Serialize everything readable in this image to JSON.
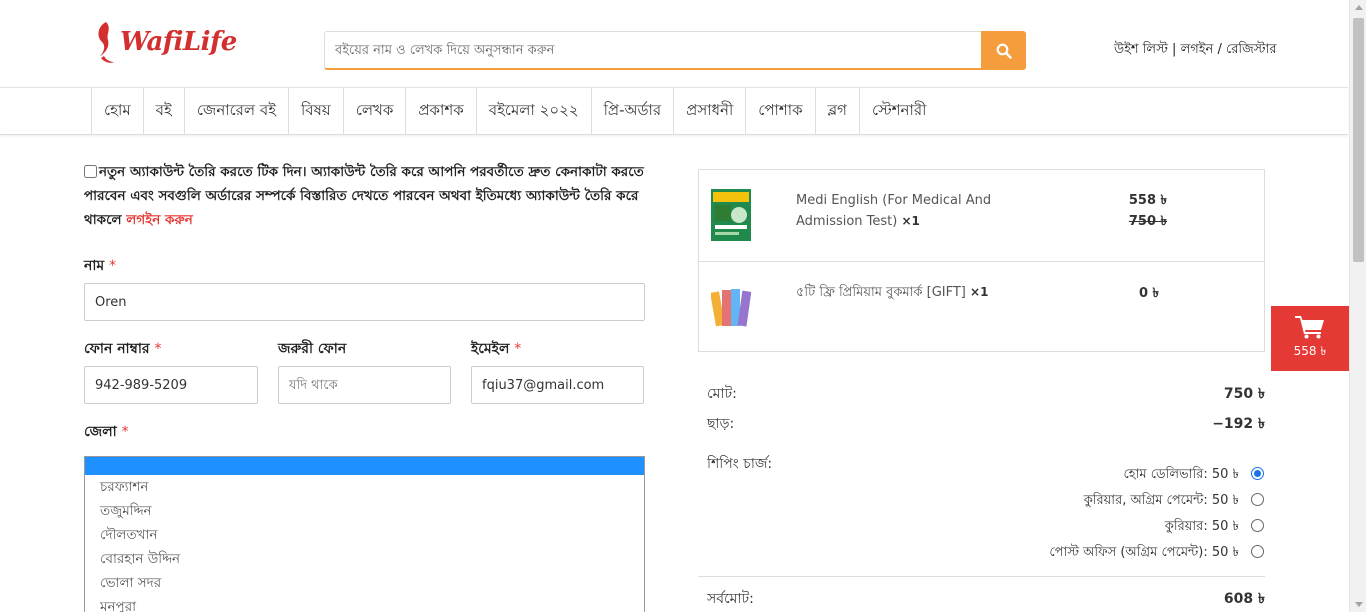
{
  "brand": {
    "name": "WafiLife",
    "color": "#d32f2f"
  },
  "search": {
    "placeholder": "বইয়ের নাম ও লেখক দিয়ে অনুসন্ধান করুন",
    "icon": "search-icon",
    "accent": "#f59d3d"
  },
  "account": {
    "wishlist": "উইশ লিস্ট",
    "sep1": " | ",
    "login": "লগইন",
    "sep2": " / ",
    "register": "রেজিস্টার"
  },
  "nav": {
    "items": [
      "হোম",
      "বই",
      "জেনারেল বই",
      "বিষয়",
      "লেখক",
      "প্রকাশক",
      "বইমেলা ২০২২",
      "প্রি-অর্ডার",
      "প্রসাধনী",
      "পোশাক",
      "ব্লগ",
      "স্টেশনারী"
    ]
  },
  "form": {
    "create_account_text": "নতুন অ্যাকাউন্ট তৈরি করতে টিক দিন। অ্যাকাউন্ট তৈরি করে আপনি পরবর্তীতে দ্রুত কেনাকাটা করতে পারবেন এবং সবগুলি অর্ডারের সম্পর্কে বিস্তারিত দেখতে পারবেন অথবা ইতিমধ্যে অ্যাকাউন্ট তৈরি করে থাকলে ",
    "login_link": "লগইন করুন",
    "name_label": "নাম",
    "name_value": "Oren",
    "phone_label": "ফোন নাম্বার",
    "phone_value": "942-989-5209",
    "alt_phone_label": "জরুরী ফোন",
    "alt_phone_placeholder": "যদি থাকে",
    "email_label": "ইমেইল",
    "email_value": "fqiu37@gmail.com",
    "district_label": "জেলা",
    "required_mark": "*",
    "district_options": [
      "",
      "চরফ্যাশন",
      "তজুমদ্দিন",
      "দৌলতখান",
      "বোরহান উদ্দিন",
      "ভোলা সদর",
      "মনপুরা"
    ]
  },
  "cart": {
    "items": [
      {
        "name": "Medi English (For Medical And Admission Test)",
        "qty": "×1",
        "price": "558 ৳",
        "old_price": "750 ৳"
      },
      {
        "name": "৫টি ফ্রি প্রিমিয়াম বুকমার্ক [GIFT]",
        "qty": "×1",
        "price": "0 ৳"
      }
    ],
    "subtotal_label": "মোট:",
    "subtotal": "750 ৳",
    "discount_label": "ছাড়:",
    "discount": "−192 ৳",
    "shipping_label": "শিপিং চার্জ:",
    "shipping_options": [
      {
        "label": "হোম ডেলিভারি: 50 ৳",
        "checked": true
      },
      {
        "label": "কুরিয়ার, অগ্রিম পেমেন্ট: 50 ৳",
        "checked": false
      },
      {
        "label": "কুরিয়ার: 50 ৳",
        "checked": false
      },
      {
        "label": "পোস্ট অফিস (অগ্রিম পেমেন্ট): 50 ৳",
        "checked": false
      }
    ],
    "total_label": "সর্বমোট:",
    "total": "608 ৳"
  },
  "float_cart": {
    "total": "558 ৳",
    "icon": "cart-icon",
    "color": "#e53935"
  }
}
